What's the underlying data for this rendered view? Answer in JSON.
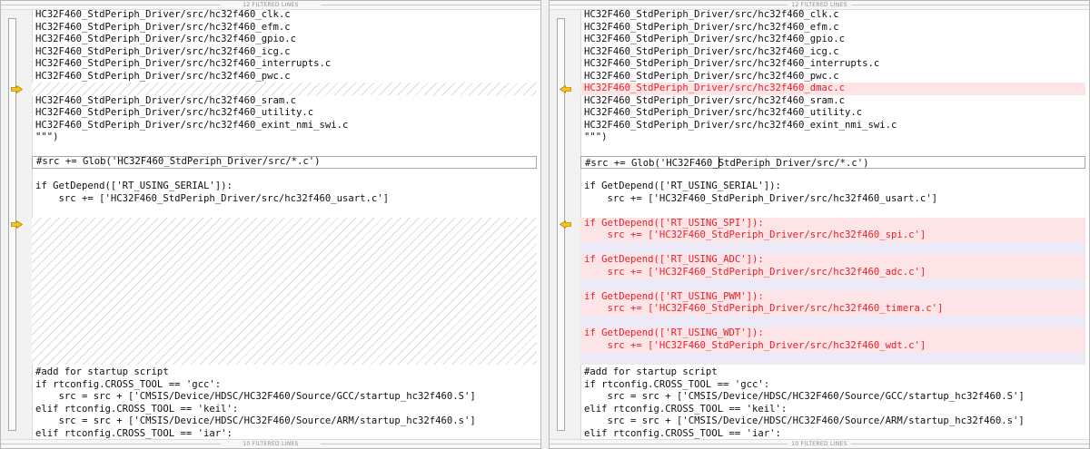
{
  "filter_label_top": "12 FILTERED LINES",
  "filter_label_bottom": "10 FILTERED LINES",
  "colors": {
    "diff_text": "#e8202a",
    "diff_bg": "#fde4e6",
    "arrow_fill": "#f5c518"
  },
  "icons": {
    "diff_marker": "arrow-icon"
  },
  "left": {
    "lines": [
      "HC32F460_StdPeriph_Driver/src/hc32f460_clk.c",
      "HC32F460_StdPeriph_Driver/src/hc32f460_efm.c",
      "HC32F460_StdPeriph_Driver/src/hc32f460_gpio.c",
      "HC32F460_StdPeriph_Driver/src/hc32f460_icg.c",
      "HC32F460_StdPeriph_Driver/src/hc32f460_interrupts.c",
      "HC32F460_StdPeriph_Driver/src/hc32f460_pwc.c",
      "HC32F460_StdPeriph_Driver/src/hc32f460_sram.c",
      "HC32F460_StdPeriph_Driver/src/hc32f460_utility.c",
      "HC32F460_StdPeriph_Driver/src/hc32f460_exint_nmi_swi.c",
      "\"\"\")",
      "#src += Glob('HC32F460_StdPeriph_Driver/src/*.c')",
      "if GetDepend(['RT_USING_SERIAL']):",
      "    src += ['HC32F460_StdPeriph_Driver/src/hc32f460_usart.c']",
      "#add for startup script",
      "if rtconfig.CROSS_TOOL == 'gcc':",
      "    src = src + ['CMSIS/Device/HDSC/HC32F460/Source/GCC/startup_hc32f460.S']",
      "elif rtconfig.CROSS_TOOL == 'keil':",
      "    src = src + ['CMSIS/Device/HDSC/HC32F460/Source/ARM/startup_hc32f460.s']",
      "elif rtconfig.CROSS_TOOL == 'iar':"
    ]
  },
  "right": {
    "lines": [
      "HC32F460_StdPeriph_Driver/src/hc32f460_clk.c",
      "HC32F460_StdPeriph_Driver/src/hc32f460_efm.c",
      "HC32F460_StdPeriph_Driver/src/hc32f460_gpio.c",
      "HC32F460_StdPeriph_Driver/src/hc32f460_icg.c",
      "HC32F460_StdPeriph_Driver/src/hc32f460_interrupts.c",
      "HC32F460_StdPeriph_Driver/src/hc32f460_pwc.c",
      "HC32F460_StdPeriph_Driver/src/hc32f460_dmac.c",
      "HC32F460_StdPeriph_Driver/src/hc32f460_sram.c",
      "HC32F460_StdPeriph_Driver/src/hc32f460_utility.c",
      "HC32F460_StdPeriph_Driver/src/hc32f460_exint_nmi_swi.c",
      "\"\"\")",
      "#src += Glob('HC32F460_",
      "StdPeriph_Driver/src/*.c')",
      "if GetDepend(['RT_USING_SERIAL']):",
      "    src += ['HC32F460_StdPeriph_Driver/src/hc32f460_usart.c']",
      "if GetDepend(['RT_USING_SPI']):",
      "    src += ['HC32F460_StdPeriph_Driver/src/hc32f460_spi.c']",
      "if GetDepend(['RT_USING_ADC']):",
      "    src += ['HC32F460_StdPeriph_Driver/src/hc32f460_adc.c']",
      "if GetDepend(['RT_USING_PWM']):",
      "    src += ['HC32F460_StdPeriph_Driver/src/hc32f460_timera.c']",
      "if GetDepend(['RT_USING_WDT']):",
      "    src += ['HC32F460_StdPeriph_Driver/src/hc32f460_wdt.c']",
      "#add for startup script",
      "if rtconfig.CROSS_TOOL == 'gcc':",
      "    src = src + ['CMSIS/Device/HDSC/HC32F460/Source/GCC/startup_hc32f460.S']",
      "elif rtconfig.CROSS_TOOL == 'keil':",
      "    src = src + ['CMSIS/Device/HDSC/HC32F460/Source/ARM/startup_hc32f460.s']",
      "elif rtconfig.CROSS_TOOL == 'iar':"
    ]
  }
}
